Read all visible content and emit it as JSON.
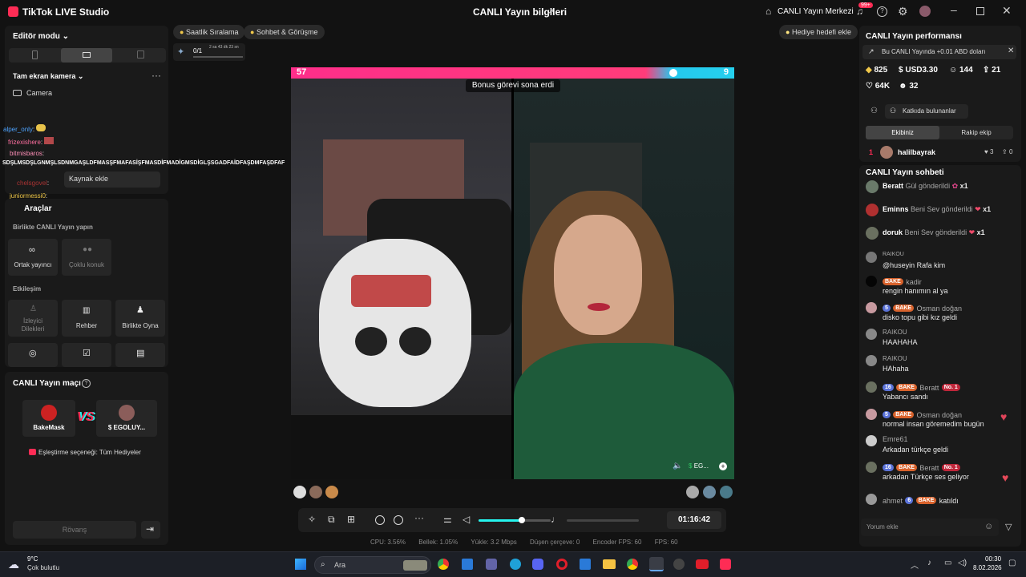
{
  "titlebar": {
    "app_title": "TikTok LIVE Studio",
    "center_title": "CANLI Yayın bilgileri",
    "center_right": "CANLI Yayın Merkezi",
    "notif_count": "99+"
  },
  "left": {
    "mode_label": "Editör modu",
    "scene_label": "Tam ekran kamera",
    "camera_label": "Camera",
    "add_source": "Kaynak ekle",
    "chat": [
      {
        "name": "alper_only",
        "msg": ":"
      },
      {
        "name": "frizexishere",
        "msg": ":"
      },
      {
        "name": "bitmisbaros",
        "msg": ":"
      },
      {
        "name": "",
        "msg": "SDŞLMSDŞLGNMŞLSDNMGAŞLDFMASŞFMAFASİŞFMASDİFMADİGMSDİGLŞSGADFAİDFAŞDMFAŞDFAF"
      },
      {
        "name": "chelsgovel",
        "msg": ":"
      },
      {
        "name": "juniormessi0",
        "msg": ":"
      }
    ],
    "tools_label": "Araçlar",
    "collab_heading": "Birlikte CANLI Yayın yapın",
    "collab": [
      "Ortak yayıncı",
      "Çoklu konuk"
    ],
    "interaction_heading": "Etkileşim",
    "interaction": [
      "İzleyici Dilekleri",
      "Rehber",
      "Birlikte Oyna"
    ],
    "match_heading": "CANLI Yayın maçı",
    "vs": "VS",
    "player1": "BakeMask",
    "player2": "$ EGOLUY...",
    "pairing": "Eşleştirme seçeneği: Tüm Hediyeler",
    "rematch": "Rövanş"
  },
  "top_pills": {
    "hourly": "Saatlik Sıralama",
    "chat_meet": "Sohbet & Görüşme",
    "gift_goal": "Hediye hedefi ekle",
    "task_count": "0/1",
    "task_time": "2 sa 43 dk 23 sn"
  },
  "video": {
    "score_left": "57",
    "score_right": "9",
    "bonus_text": "Bonus görevi sona erdi",
    "opponent_tag": "EG..."
  },
  "controls": {
    "timer": "01:16:42",
    "volume_pct": 0.6
  },
  "stats": {
    "cpu": "CPU: 3.56%",
    "mem": "Bellek: 1.05%",
    "upload": "Yükle: 3.2 Mbps",
    "dropped": "Düşen çerçeve: 0",
    "encoder_fps": "Encoder FPS: 60",
    "fps": "FPS: 60"
  },
  "right": {
    "perf_heading": "CANLI Yayın performansı",
    "perf_banner": "Bu CANLI Yayında +0.01 ABD doları",
    "coins": "825",
    "usd": "USD3.30",
    "viewers": "144",
    "shares": "21",
    "likes": "64K",
    "followers": "32",
    "contributors": "Katkıda bulunanlar",
    "tab_team": "Ekibiniz",
    "tab_rival": "Rakip ekip",
    "rank_no": "1",
    "rank_name": "halilbayrak",
    "rank_likes": "3",
    "rank_gifts": "0",
    "chat_heading": "CANLI Yayın sohbeti",
    "gifts": [
      {
        "name": "Beratt",
        "text": "Gül gönderildi",
        "count": "x1"
      },
      {
        "name": "Eminns",
        "text": "Beni Sev gönderildi",
        "count": "x1"
      },
      {
        "name": "doruk",
        "text": "Beni Sev gönderildi",
        "count": "x1"
      }
    ],
    "messages": [
      {
        "name": "RAIKOU",
        "msg": "@huseyin Rafa kim"
      },
      {
        "name": "kadir",
        "badge": "BAKE",
        "msg": "rengin hanımın al ya"
      },
      {
        "name": "Osman doğan",
        "level": "5",
        "badge": "BAKE",
        "msg": "disko topu gibi kız geldi"
      },
      {
        "name": "RAIKOU",
        "msg": "HAAHAHA"
      },
      {
        "name": "RAIKOU",
        "msg": "HAhaha"
      },
      {
        "name": "Beratt",
        "level": "16",
        "badge": "BAKE",
        "rank": "No. 1",
        "msg": "Yabancı sandı"
      },
      {
        "name": "Osman doğan",
        "level": "5",
        "badge": "BAKE",
        "msg": "normal insan göremedim bugün"
      },
      {
        "name": "Emre61",
        "msg": "Arkadan türkçe geldi"
      },
      {
        "name": "Beratt",
        "level": "16",
        "badge": "BAKE",
        "rank": "No. 1",
        "msg": "arkadan Türkçe ses geliyor"
      },
      {
        "name": "ahmet",
        "level": "6",
        "badge": "BAKE",
        "msg": "katıldı"
      }
    ],
    "comment_placeholder": "Yorum ekle"
  },
  "taskbar": {
    "temp": "9°C",
    "weather": "Çok bulutlu",
    "search": "Ara",
    "time": "00:30",
    "date": "8.02.2026"
  },
  "colors": {
    "accent_pink": "#fe2c55",
    "accent_cyan": "#25f4ee",
    "bg": "#121212",
    "panel": "#1a1a1a"
  }
}
